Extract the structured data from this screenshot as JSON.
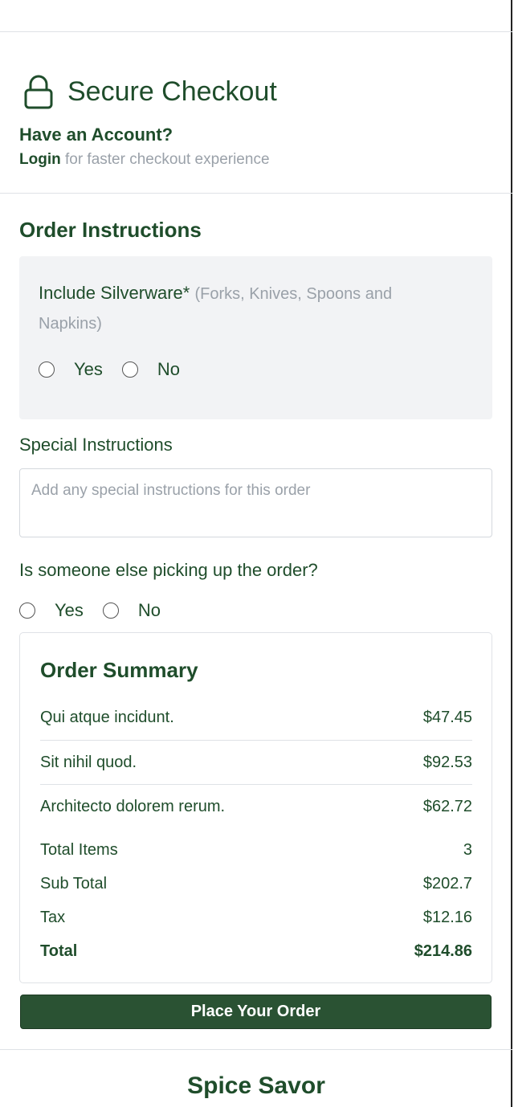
{
  "header": {
    "title": "Secure Checkout",
    "account_heading": "Have an Account?",
    "login_link": "Login",
    "login_hint": " for faster checkout experience"
  },
  "order_instructions": {
    "section_title": "Order Instructions",
    "silverware_label": "Include Silverware*",
    "silverware_note": "(Forks, Knives, Spoons and Napkins)",
    "silverware_options": [
      "Yes",
      "No"
    ],
    "special_label": "Special Instructions",
    "special_placeholder": "Add any special instructions for this order",
    "pickup_question": "Is someone else picking up the order?",
    "pickup_options": [
      "Yes",
      "No"
    ]
  },
  "summary": {
    "title": "Order Summary",
    "items": [
      {
        "name": "Qui atque incidunt.",
        "price": "$47.45"
      },
      {
        "name": "Sit nihil quod.",
        "price": "$92.53"
      },
      {
        "name": "Architecto dolorem rerum.",
        "price": "$62.72"
      }
    ],
    "totals": [
      {
        "label": "Total Items",
        "value": "3"
      },
      {
        "label": "Sub Total",
        "value": "$202.7"
      },
      {
        "label": "Tax",
        "value": "$12.16"
      },
      {
        "label": "Total",
        "value": "$214.86"
      }
    ]
  },
  "actions": {
    "place_order": "Place Your Order"
  },
  "footer": {
    "brand": "Spice Savor"
  },
  "colors": {
    "primary": "#2a5233",
    "text": "#1f4d2b",
    "muted": "#9aa1a9",
    "panel": "#f2f3f5"
  }
}
